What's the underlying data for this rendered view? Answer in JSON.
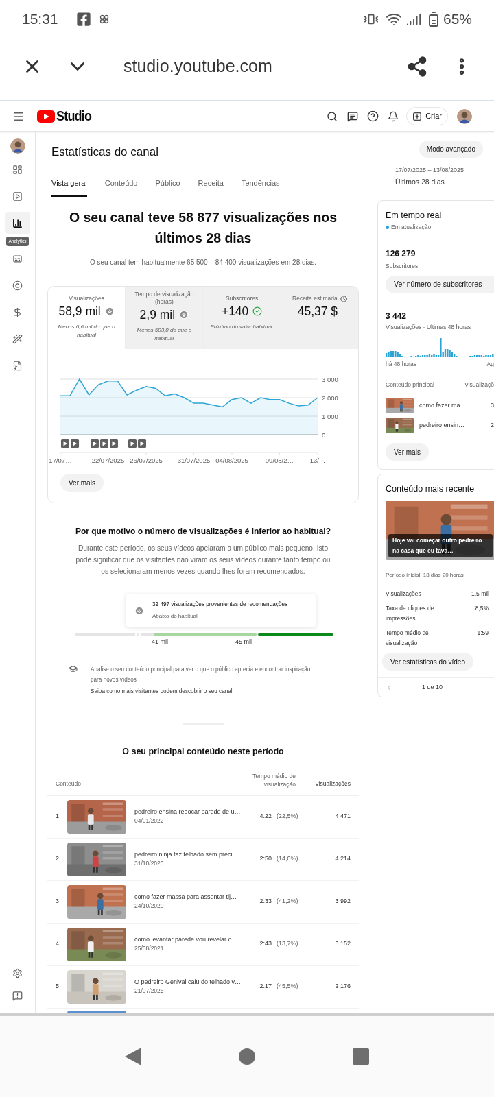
{
  "status_bar": {
    "time": "15:31",
    "battery": "65%"
  },
  "browser": {
    "url": "studio.youtube.com"
  },
  "header": {
    "logo_text": "Studio",
    "create_label": "Criar"
  },
  "sidebar": {
    "items": [
      {
        "selected": false
      },
      {
        "selected": false
      },
      {
        "selected": true
      },
      {
        "selected": false
      },
      {
        "selected": false
      },
      {
        "selected": false
      },
      {
        "selected": false
      },
      {
        "selected": false
      }
    ],
    "tooltip": "Analytics"
  },
  "page": {
    "title": "Estatísticas do canal",
    "advanced_button": "Modo avançado",
    "date_range": "17/07/2025 – 13/08/2025",
    "period": "Últimos 28 dias",
    "tabs": [
      {
        "label": "Vista geral",
        "selected": true
      },
      {
        "label": "Conteúdo",
        "selected": false
      },
      {
        "label": "Público",
        "selected": false
      },
      {
        "label": "Receita",
        "selected": false
      },
      {
        "label": "Tendências",
        "selected": false
      }
    ]
  },
  "summary": {
    "headline": "O seu canal teve 58 877 visualizações nos últimos 28 dias",
    "subtitle": "O seu canal tem habitualmente 65 500 – 84 400 visualizações em 28 dias."
  },
  "metrics": [
    {
      "label": "Visualizações",
      "value": "58,9 mil",
      "kind": "down",
      "note": "Menos 6,6 mil do que o habitual",
      "info": false,
      "selected": true
    },
    {
      "label": "Tempo de visualização (horas)",
      "value": "2,9 mil",
      "kind": "down",
      "note": "Menos 583,8 do que o habitual",
      "info": false,
      "selected": false
    },
    {
      "label": "Subscritores",
      "value": "+140",
      "kind": "normal",
      "note": "Próximo do valor habitual.",
      "info": false,
      "selected": false
    },
    {
      "label": "Receita estimada",
      "value": "45,37 $",
      "kind": "plain",
      "info": true,
      "selected": false
    }
  ],
  "chart_data": {
    "type": "area",
    "categories": [
      "17/07…",
      null,
      null,
      null,
      null,
      "22/07/2025",
      null,
      null,
      null,
      "26/07/2025",
      null,
      null,
      null,
      null,
      "31/07/2025",
      null,
      null,
      null,
      "04/08/2025",
      null,
      null,
      null,
      null,
      "09/08/2…",
      null,
      null,
      null,
      "13/…"
    ],
    "series": [
      {
        "color": "#2ba4d6",
        "values": [
          2100,
          2100,
          3000,
          2150,
          2700,
          2900,
          2900,
          2150,
          2400,
          2600,
          2500,
          2100,
          2200,
          2000,
          1700,
          1700,
          1600,
          1500,
          1900,
          2000,
          1700,
          2000,
          1900,
          1900,
          1700,
          1550,
          1600,
          2000
        ]
      }
    ],
    "ylim": [
      0,
      3000
    ],
    "yticks": [
      {
        "value": 0,
        "label": "0"
      },
      {
        "value": 1000,
        "label": "1 000"
      },
      {
        "value": 2000,
        "label": "2 000"
      },
      {
        "value": 3000,
        "label": "3 000"
      }
    ]
  },
  "see_more": "Ver mais",
  "explanation": {
    "title": "Por que motivo o número de visualizações é inferior ao habitual?",
    "body": "Durante este período, os seus vídeos apelaram a um público mais pequeno. Isto pode significar que os visitantes não viram os seus vídeos durante tanto tempo ou os selecionaram menos vezes quando lhes foram recomendados.",
    "callout": {
      "text": "32 497 visualizações provenientes de recomendações",
      "subtext": "Abaixo do habitual"
    },
    "marker": {
      "level": 0.245
    },
    "range_labels": [
      "41 mil",
      "45 mil"
    ],
    "tip": "Analise o seu conteúdo principal para ver o que o público aprecia e encontrar inspiração para novos vídeos",
    "link": "Saiba como mais visitantes podem descobrir o seu canal"
  },
  "top_content": {
    "title": "O seu principal conteúdo neste período",
    "columns": [
      "Conteúdo",
      "Tempo médio de visualização",
      "Visualizações"
    ],
    "rows": [
      {
        "rank": "1",
        "title": "pedreiro ensina rebocar parede de u…",
        "date": "04/01/2022",
        "avg_time": "4:22",
        "percent": "(22,5%)",
        "views": "4 471"
      },
      {
        "rank": "2",
        "title": "pedreiro ninja faz telhado sem preci…",
        "date": "31/10/2020",
        "avg_time": "2:50",
        "percent": "(14,0%)",
        "views": "4 214"
      },
      {
        "rank": "3",
        "title": "como fazer massa para assentar tij…",
        "date": "24/10/2020",
        "avg_time": "2:33",
        "percent": "(41,2%)",
        "views": "3 992"
      },
      {
        "rank": "4",
        "title": "como levantar parede vou revelar o…",
        "date": "25/08/2021",
        "avg_time": "2:43",
        "percent": "(13,7%)",
        "views": "3 152"
      },
      {
        "rank": "5",
        "title": "O pedreiro Genival caiu do telhado v…",
        "date": "21/07/2025",
        "avg_time": "2:17",
        "percent": "(45,5%)",
        "views": "2 176"
      }
    ],
    "partial_row": {
      "kind": "picture"
    }
  },
  "realtime": {
    "title": "Em tempo real",
    "status": "Em atualização",
    "subscribers": "126 279",
    "subscribers_label": "Subscritores",
    "subscribers_button": "Ver número de subscritores",
    "views": "3 442",
    "views_label": "Visualizações · Últimas 48 horas",
    "axis_start": "há 48 horas",
    "axis_end": "Ag",
    "columns": [
      "Conteúdo principal",
      "Visualizaçõ"
    ],
    "items": [
      {
        "title": "como fazer ma…",
        "views": "3"
      },
      {
        "title": "pedreiro ensin…",
        "views": "2"
      }
    ],
    "see_more": "Ver mais"
  },
  "latest": {
    "title": "Conteúdo mais recente",
    "video_title": "Hoje vai começar outro pedreiro na casa que eu tava…",
    "period": "Período inicial: 18 dias 20 horas",
    "stats": [
      {
        "label": "Visualizações",
        "value": "1,5 mil"
      },
      {
        "label": "Taxa de cliques de impressões",
        "value": "8,5%"
      },
      {
        "label": "Tempo médio de visualização",
        "value": "1:59"
      }
    ],
    "button": "Ver estatísticas do vídeo",
    "pager": "1 de 10"
  }
}
